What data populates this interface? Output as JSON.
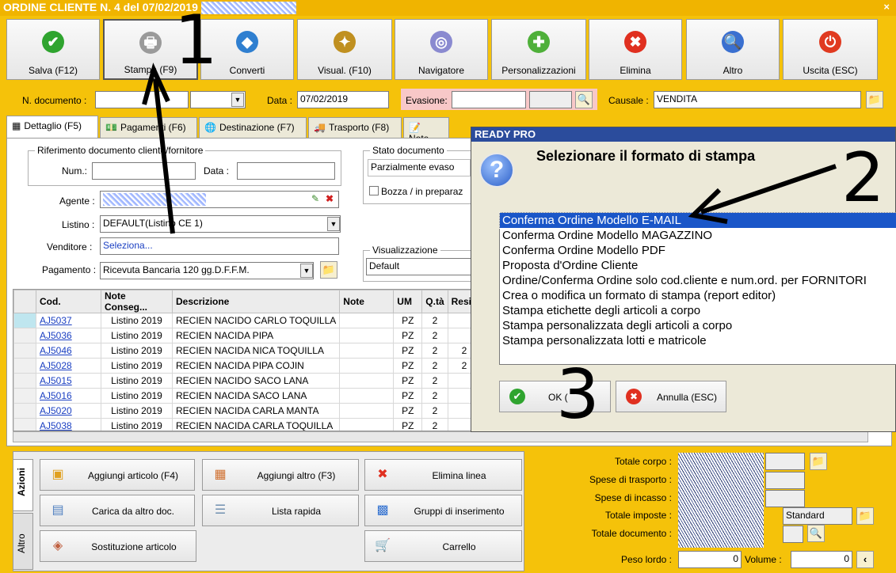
{
  "window": {
    "title": "ORDINE CLIENTE N. 4 del 07/02/2019",
    "close": "×"
  },
  "toolbar": [
    {
      "label": "Salva (F12)",
      "icon": "check-icon",
      "color": "#2fa42f",
      "glyph": "✔"
    },
    {
      "label": "Stampa (F9)",
      "icon": "printer-icon",
      "color": "#9a9a9a",
      "glyph": "🖶"
    },
    {
      "label": "Converti",
      "icon": "shapes-icon",
      "color": "#2f7fd0",
      "glyph": "◆"
    },
    {
      "label": "Visual. (F10)",
      "icon": "magic-wand-icon",
      "color": "#c09020",
      "glyph": "✦"
    },
    {
      "label": "Navigatore",
      "icon": "compass-icon",
      "color": "#8a8ad0",
      "glyph": "◎"
    },
    {
      "label": "Personalizzazioni",
      "icon": "puzzle-icon",
      "color": "#4fb03a",
      "glyph": "✚"
    },
    {
      "label": "Elimina",
      "icon": "delete-x-icon",
      "color": "#e03020",
      "glyph": "✖"
    },
    {
      "label": "Altro",
      "icon": "search-doc-icon",
      "color": "#3a70d0",
      "glyph": "🔍"
    },
    {
      "label": "Uscita (ESC)",
      "icon": "power-icon",
      "color": "#e03a20",
      "glyph": "⏻"
    }
  ],
  "header": {
    "doc_label": "N. documento :",
    "data_label": "Data :",
    "data_value": "07/02/2019",
    "evasione_label": "Evasione:",
    "causale_label": "Causale :",
    "causale_value": "VENDITA"
  },
  "tabs": [
    {
      "label": "Dettaglio (F5)",
      "icon": "grid-icon"
    },
    {
      "label": "Pagamenti (F6)",
      "icon": "money-icon"
    },
    {
      "label": "Destinazione (F7)",
      "icon": "globe-icon"
    },
    {
      "label": "Trasporto (F8)",
      "icon": "truck-icon"
    },
    {
      "label": "Note",
      "icon": "note-icon"
    }
  ],
  "riferimento": {
    "title": "Riferimento documento cliente/fornitore",
    "num_label": "Num.:",
    "data_label": "Data :"
  },
  "stato": {
    "title": "Stato documento",
    "value": "Parzialmente evaso",
    "bozza_label": "Bozza / in preparaz"
  },
  "fields": {
    "agente_label": "Agente :",
    "listino_label": "Listino :",
    "listino_value": "DEFAULT(Listino CE 1)",
    "venditore_label": "Venditore :",
    "venditore_value": "Seleziona...",
    "pagamento_label": "Pagamento :",
    "pagamento_value": "Ricevuta Bancaria 120 gg.D.F.F.M.",
    "visualizzazione_title": "Visualizzazione",
    "visualizzazione_value": "Default"
  },
  "grid": {
    "headers": [
      "Cod.",
      "Note Conseg...",
      "Descrizione",
      "Note",
      "UM",
      "Q.tà",
      "Resid"
    ],
    "rows": [
      [
        "AJ5037",
        "Listino 2019",
        "RECIEN NACIDO CARLO TOQUILLA",
        "",
        "PZ",
        "2",
        ""
      ],
      [
        "AJ5036",
        "Listino 2019",
        "RECIEN NACIDA PIPA",
        "",
        "PZ",
        "2",
        ""
      ],
      [
        "AJ5046",
        "Listino 2019",
        "RECIEN NACIDA NICA TOQUILLA",
        "",
        "PZ",
        "2",
        "2"
      ],
      [
        "AJ5028",
        "Listino 2019",
        "RECIEN NACIDA PIPA COJIN",
        "",
        "PZ",
        "2",
        "2"
      ],
      [
        "AJ5015",
        "Listino 2019",
        "RECIEN NACIDO SACO LANA",
        "",
        "PZ",
        "2",
        ""
      ],
      [
        "AJ5016",
        "Listino 2019",
        "RECIEN NACIDA SACO LANA",
        "",
        "PZ",
        "2",
        ""
      ],
      [
        "AJ5020",
        "Listino 2019",
        "RECIEN NACIDA CARLA MANTA",
        "",
        "PZ",
        "2",
        ""
      ],
      [
        "AJ5038",
        "Listino 2019",
        "RECIEN NACIDA CARLA TOQUILLA",
        "",
        "PZ",
        "2",
        ""
      ]
    ]
  },
  "side_tabs": {
    "azioni": "Azioni",
    "altro": "Altro"
  },
  "actions": [
    {
      "label": "Aggiungi articolo (F4)",
      "icon": "add-box-icon",
      "glyph": "▣"
    },
    {
      "label": "Aggiungi altro (F3)",
      "icon": "add-grid-icon",
      "glyph": "▦"
    },
    {
      "label": "Elimina linea",
      "icon": "delete-x-icon",
      "glyph": "✖"
    },
    {
      "label": "Carica da altro doc.",
      "icon": "load-doc-icon",
      "glyph": "▤"
    },
    {
      "label": "Lista rapida",
      "icon": "quick-list-icon",
      "glyph": "☰"
    },
    {
      "label": "Gruppi di inserimento",
      "icon": "group-add-icon",
      "glyph": "▩"
    },
    {
      "label": "Sostituzione articolo",
      "icon": "replace-icon",
      "glyph": "◈"
    },
    {
      "label": "Carrello",
      "icon": "cart-icon",
      "glyph": "🛒"
    }
  ],
  "totals": {
    "totale_corpo": "Totale corpo :",
    "spese_trasporto": "Spese di trasporto :",
    "spese_incasso": "Spese di incasso :",
    "totale_imposte": "Totale imposte :",
    "totale_documento": "Totale documento :",
    "standard": "Standard",
    "peso_label": "Peso lordo :",
    "peso_value": "0",
    "volume_label": "Volume :",
    "volume_value": "0"
  },
  "dialog": {
    "title": "READY PRO",
    "heading": "Selezionare il formato di stampa",
    "options": [
      "Conferma Ordine Modello E-MAIL",
      "Conferma Ordine Modello MAGAZZINO",
      "Conferma Ordine Modello PDF",
      "Proposta d'Ordine Cliente",
      "Ordine/Conferma Ordine solo cod.cliente e num.ord. per FORNITORI",
      "Crea o modifica un formato di stampa (report editor)",
      "Stampa etichette degli articoli a corpo",
      "Stampa personalizzata degli articoli a corpo",
      "Stampa personalizzata lotti e matricole"
    ],
    "ok_label": "OK (",
    "cancel_label": "Annulla (ESC)"
  },
  "annotations": [
    "1",
    "2",
    "3"
  ]
}
